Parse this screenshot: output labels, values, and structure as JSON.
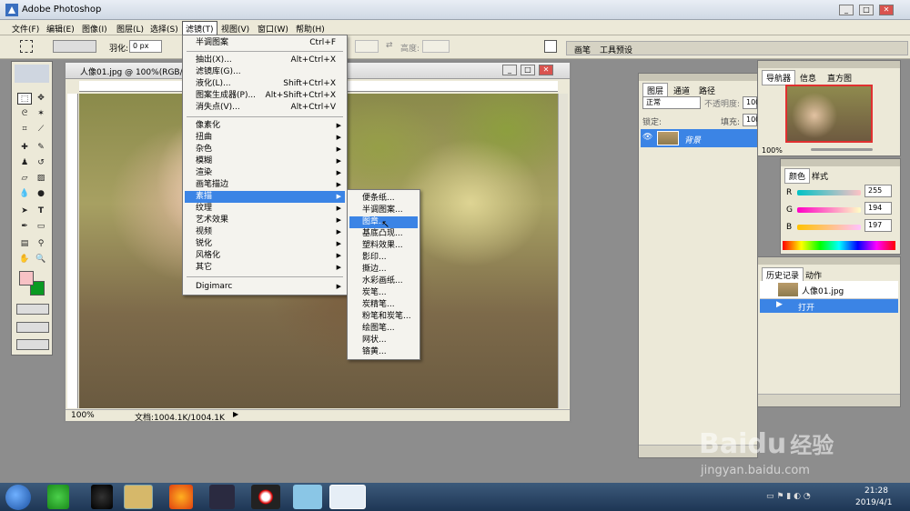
{
  "app": {
    "title": "Adobe Photoshop",
    "win_buttons": [
      "_",
      "□",
      "✕"
    ]
  },
  "menubar": [
    {
      "label": "文件(F)"
    },
    {
      "label": "编辑(E)"
    },
    {
      "label": "图像(I)"
    },
    {
      "label": "图层(L)"
    },
    {
      "label": "选择(S)"
    },
    {
      "label": "滤镜(T)"
    },
    {
      "label": "视图(V)"
    },
    {
      "label": "窗口(W)"
    },
    {
      "label": "帮助(H)"
    }
  ],
  "options": {
    "feather_label": "羽化:",
    "feather_value": "0 px",
    "height_label": "高度:",
    "palette_tabs": [
      "画笔",
      "工具预设"
    ]
  },
  "document": {
    "title": "人像01.jpg @ 100%(RGB/...",
    "zoom": "100%",
    "doc_info": "文档:1004.1K/1004.1K"
  },
  "filter_menu": {
    "items": [
      {
        "label": "半调图案",
        "shortcut": "Ctrl+F"
      },
      {
        "label": "抽出(X)...",
        "shortcut": "Alt+Ctrl+X"
      },
      {
        "label": "滤镜库(G)..."
      },
      {
        "label": "液化(L)...",
        "shortcut": "Shift+Ctrl+X"
      },
      {
        "label": "图案生成器(P)...",
        "shortcut": "Alt+Shift+Ctrl+X"
      },
      {
        "label": "消失点(V)...",
        "shortcut": "Alt+Ctrl+V"
      },
      {
        "label": "像素化"
      },
      {
        "label": "扭曲"
      },
      {
        "label": "杂色"
      },
      {
        "label": "模糊"
      },
      {
        "label": "渲染"
      },
      {
        "label": "画笔描边"
      },
      {
        "label": "素描"
      },
      {
        "label": "纹理"
      },
      {
        "label": "艺术效果"
      },
      {
        "label": "视频"
      },
      {
        "label": "锐化"
      },
      {
        "label": "风格化"
      },
      {
        "label": "其它"
      },
      {
        "label": "Digimarc"
      }
    ]
  },
  "sketch_submenu": {
    "items": [
      {
        "label": "便条纸..."
      },
      {
        "label": "半调图案..."
      },
      {
        "label": "图章..."
      },
      {
        "label": "基底凸现..."
      },
      {
        "label": "塑料效果..."
      },
      {
        "label": "影印..."
      },
      {
        "label": "撕边..."
      },
      {
        "label": "水彩画纸..."
      },
      {
        "label": "炭笔..."
      },
      {
        "label": "炭精笔..."
      },
      {
        "label": "粉笔和炭笔..."
      },
      {
        "label": "绘图笔..."
      },
      {
        "label": "网状..."
      },
      {
        "label": "铬黄..."
      }
    ]
  },
  "layers_panel": {
    "tabs": [
      "图层",
      "通道",
      "路径"
    ],
    "mode": "正常",
    "opacity_label": "不透明度:",
    "opacity_value": "100",
    "lock_label": "锁定:",
    "fill_label": "填充:",
    "fill_value": "100",
    "layer_name": "背景"
  },
  "navigator_panel": {
    "tabs": [
      "导航器",
      "信息",
      "直方图"
    ],
    "zoom": "100%"
  },
  "color_panel": {
    "tabs": [
      "颜色",
      "样式"
    ],
    "r_label": "R",
    "r": "255",
    "g_label": "G",
    "g": "194",
    "b_label": "B",
    "b": "197"
  },
  "history_panel": {
    "tabs": [
      "历史记录",
      "动作"
    ],
    "snapshot": "人像01.jpg",
    "step": "打开"
  },
  "watermark": {
    "brand": "Baidu",
    "brand_cn": "经验",
    "url": "jingyan.baidu.com"
  },
  "taskbar": {
    "time": "21:28",
    "date": "2019/4/1"
  },
  "colors": {
    "highlight": "#3b84e5",
    "fg_swatch": "#f7c2c5",
    "bg_swatch": "#0a9a22"
  }
}
